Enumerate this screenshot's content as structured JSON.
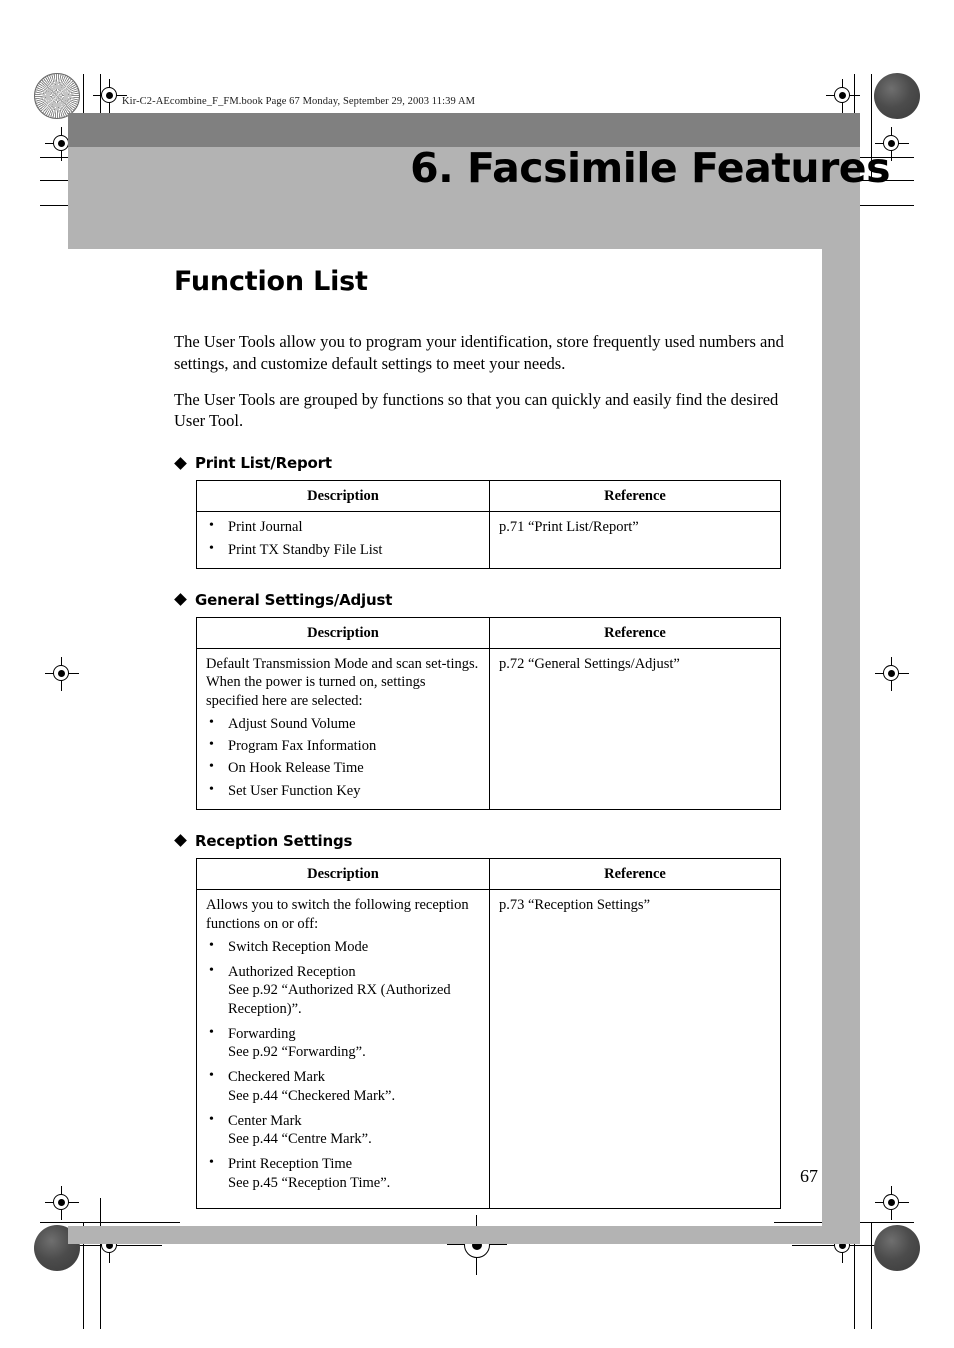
{
  "print_marks": {
    "file_header": "Kir-C2-AEcombine_F_FM.book  Page 67  Monday, September 29, 2003  11:39 AM"
  },
  "chapter": {
    "title": "6. Facsimile Features"
  },
  "page": {
    "number": "67",
    "section_title": "Function List",
    "paragraphs": [
      "The User Tools allow you to program your identification, store frequently used numbers and settings, and customize default settings to meet your needs.",
      "The User Tools are grouped by functions so that you can quickly and easily find the desired User Tool."
    ]
  },
  "table_headers": {
    "description": "Description",
    "reference": "Reference"
  },
  "sections": [
    {
      "heading": "Print List/Report",
      "intro": "",
      "items": [
        {
          "text": "Print Journal",
          "note": ""
        },
        {
          "text": "Print TX Standby File List",
          "note": ""
        }
      ],
      "reference": "p.71 “Print List/Report”"
    },
    {
      "heading": "General Settings/Adjust",
      "intro": "Default Transmission Mode and scan set-tings. When the power is turned on, settings specified here are selected:",
      "items": [
        {
          "text": "Adjust Sound Volume",
          "note": ""
        },
        {
          "text": "Program Fax Information",
          "note": ""
        },
        {
          "text": "On Hook Release Time",
          "note": ""
        },
        {
          "text": "Set User Function Key",
          "note": ""
        }
      ],
      "reference": "p.72 “General Settings/Adjust”"
    },
    {
      "heading": "Reception Settings",
      "intro": "Allows you to switch the following reception functions on or off:",
      "items": [
        {
          "text": "Switch Reception Mode",
          "note": ""
        },
        {
          "text": "Authorized Reception",
          "note": "See p.92 “Authorized RX (Authorized Reception)”."
        },
        {
          "text": "Forwarding",
          "note": "See p.92 “Forwarding”."
        },
        {
          "text": "Checkered Mark",
          "note": "See p.44 “Checkered Mark”."
        },
        {
          "text": "Center Mark",
          "note": "See p.44 “Centre Mark”."
        },
        {
          "text": "Print Reception Time",
          "note": "See p.45 “Reception Time”."
        }
      ],
      "reference": "p.73 “Reception Settings”"
    }
  ]
}
